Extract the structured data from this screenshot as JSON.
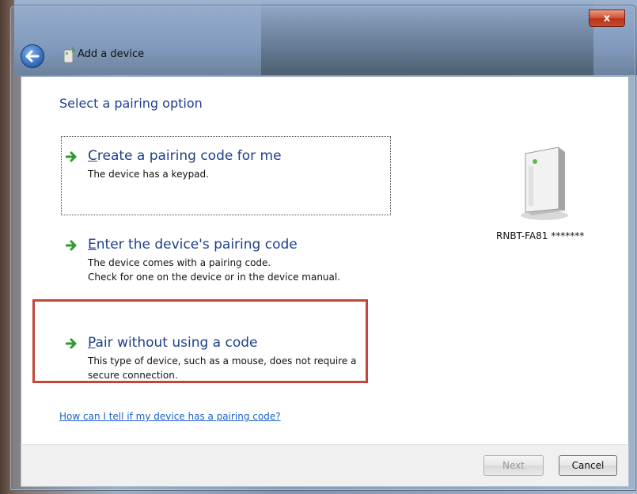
{
  "window": {
    "title": "Add a device",
    "close_label": "x"
  },
  "main": {
    "heading": "Select a pairing option",
    "options": [
      {
        "title_first": "C",
        "title_rest": "reate a pairing code for me",
        "description": [
          "The device has a keypad."
        ]
      },
      {
        "title_first": "E",
        "title_rest": "nter the device's pairing code",
        "description": [
          "The device comes with a pairing code.",
          "Check for one on the device or in the device manual."
        ]
      },
      {
        "title_first": "P",
        "title_rest": "air without using a code",
        "description": [
          "This type of device, such as a mouse, does not require a",
          "secure connection."
        ]
      }
    ],
    "help_link": "How can I tell if my device has a pairing code?",
    "device_label": "RNBT-FA81 *******"
  },
  "footer": {
    "next_label": "Next",
    "cancel_label": "Cancel"
  },
  "colors": {
    "accent_blue": "#1e3f8a",
    "arrow_green": "#2e9b2e",
    "highlight_red": "#c0463a",
    "link_blue": "#1a5fc9"
  },
  "icons": {
    "back": "back-arrow-icon",
    "title_device": "device-icon",
    "option_arrow": "green-arrow-icon",
    "device_large": "device-tower-icon"
  }
}
